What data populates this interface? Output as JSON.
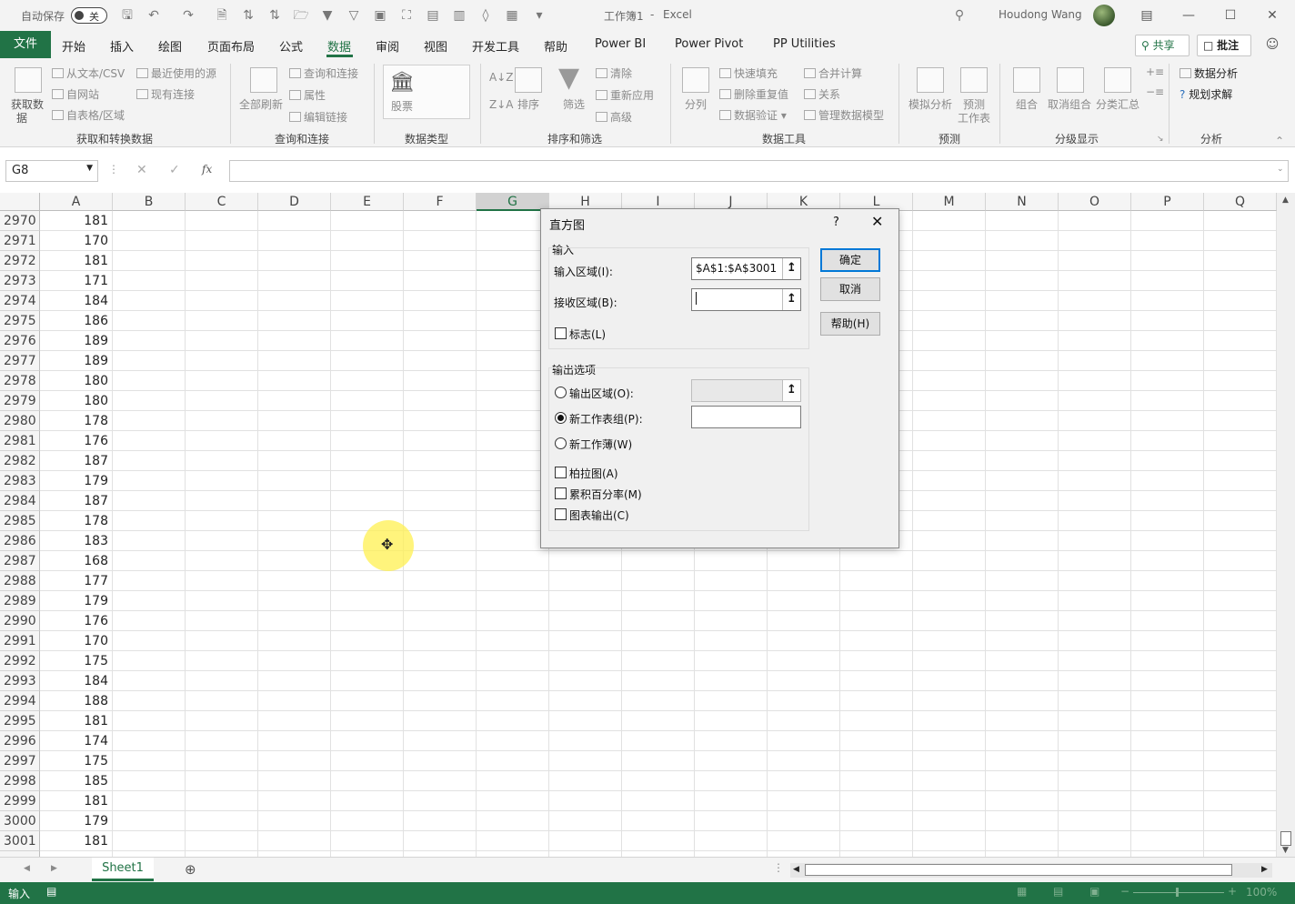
{
  "titlebar": {
    "autosave_label": "自动保存",
    "autosave_state": "关",
    "doc_title": "工作簿1",
    "separator": "-",
    "app_name": "Excel",
    "user_name": "Houdong Wang"
  },
  "ribbon_tabs": [
    "文件",
    "开始",
    "插入",
    "绘图",
    "页面布局",
    "公式",
    "数据",
    "审阅",
    "视图",
    "开发工具",
    "帮助",
    "Power BI",
    "Power Pivot",
    "PP Utilities"
  ],
  "active_tab": "数据",
  "share_label": "共享",
  "comment_label": "批注",
  "ribbon": {
    "get_data": "获取数",
    "get_data2": "据",
    "from_text": "从文本/CSV",
    "from_web": "自网站",
    "from_table": "自表格/区域",
    "recent_sources": "最近使用的源",
    "existing_conn": "现有连接",
    "group1": "获取和转换数据",
    "refresh_all": "全部刷新",
    "queries_conn": "查询和连接",
    "properties": "属性",
    "edit_links": "编辑链接",
    "group2": "查询和连接",
    "stocks": "股票",
    "group3": "数据类型",
    "sort": "排序",
    "filter": "筛选",
    "clear": "清除",
    "reapply": "重新应用",
    "advanced": "高级",
    "group4": "排序和筛选",
    "text_to_cols": "分列",
    "flash_fill": "快速填充",
    "remove_dups": "删除重复值",
    "data_validation": "数据验证",
    "consolidate": "合并计算",
    "relationships": "关系",
    "manage_model": "管理数据模型",
    "group5": "数据工具",
    "what_if": "模拟分析",
    "forecast_sheet": "预测",
    "forecast_sheet2": "工作表",
    "group6": "预测",
    "group_btn": "组合",
    "ungroup": "取消组合",
    "subtotal": "分类汇总",
    "group7": "分级显示",
    "data_analysis": "数据分析",
    "solver": "规划求解",
    "group8": "分析"
  },
  "formula_bar": {
    "name_box": "G8",
    "fx": "fx",
    "value": ""
  },
  "columns": [
    "A",
    "B",
    "C",
    "D",
    "E",
    "F",
    "G",
    "H",
    "I",
    "J",
    "K",
    "L",
    "M",
    "N",
    "O",
    "P",
    "Q"
  ],
  "selected_column": "G",
  "rows": [
    {
      "n": "2970",
      "a": "181"
    },
    {
      "n": "2971",
      "a": "170"
    },
    {
      "n": "2972",
      "a": "181"
    },
    {
      "n": "2973",
      "a": "171"
    },
    {
      "n": "2974",
      "a": "184"
    },
    {
      "n": "2975",
      "a": "186"
    },
    {
      "n": "2976",
      "a": "189"
    },
    {
      "n": "2977",
      "a": "189"
    },
    {
      "n": "2978",
      "a": "180"
    },
    {
      "n": "2979",
      "a": "180"
    },
    {
      "n": "2980",
      "a": "178"
    },
    {
      "n": "2981",
      "a": "176"
    },
    {
      "n": "2982",
      "a": "187"
    },
    {
      "n": "2983",
      "a": "179"
    },
    {
      "n": "2984",
      "a": "187"
    },
    {
      "n": "2985",
      "a": "178"
    },
    {
      "n": "2986",
      "a": "183"
    },
    {
      "n": "2987",
      "a": "168"
    },
    {
      "n": "2988",
      "a": "177"
    },
    {
      "n": "2989",
      "a": "179"
    },
    {
      "n": "2990",
      "a": "176"
    },
    {
      "n": "2991",
      "a": "170"
    },
    {
      "n": "2992",
      "a": "175"
    },
    {
      "n": "2993",
      "a": "184"
    },
    {
      "n": "2994",
      "a": "188"
    },
    {
      "n": "2995",
      "a": "181"
    },
    {
      "n": "2996",
      "a": "174"
    },
    {
      "n": "2997",
      "a": "175"
    },
    {
      "n": "2998",
      "a": "185"
    },
    {
      "n": "2999",
      "a": "181"
    },
    {
      "n": "3000",
      "a": "179"
    },
    {
      "n": "3001",
      "a": "181"
    }
  ],
  "sheet_tab": "Sheet1",
  "status": {
    "mode": "输入",
    "zoom": "100%"
  },
  "dialog": {
    "title": "直方图",
    "help_q": "?",
    "input_section": "输入",
    "input_range_label": "输入区域(I):",
    "input_range_value": "$A$1:$A$3001",
    "bin_range_label": "接收区域(B):",
    "bin_range_value": "",
    "labels_label": "标志(L)",
    "output_section": "输出选项",
    "output_range_label": "输出区域(O):",
    "new_sheet_label": "新工作表组(P):",
    "new_workbook_label": "新工作薄(W)",
    "pareto_label": "柏拉图(A)",
    "cumulative_label": "累积百分率(M)",
    "chart_output_label": "图表输出(C)",
    "ok": "确定",
    "cancel": "取消",
    "help": "帮助(H)"
  }
}
